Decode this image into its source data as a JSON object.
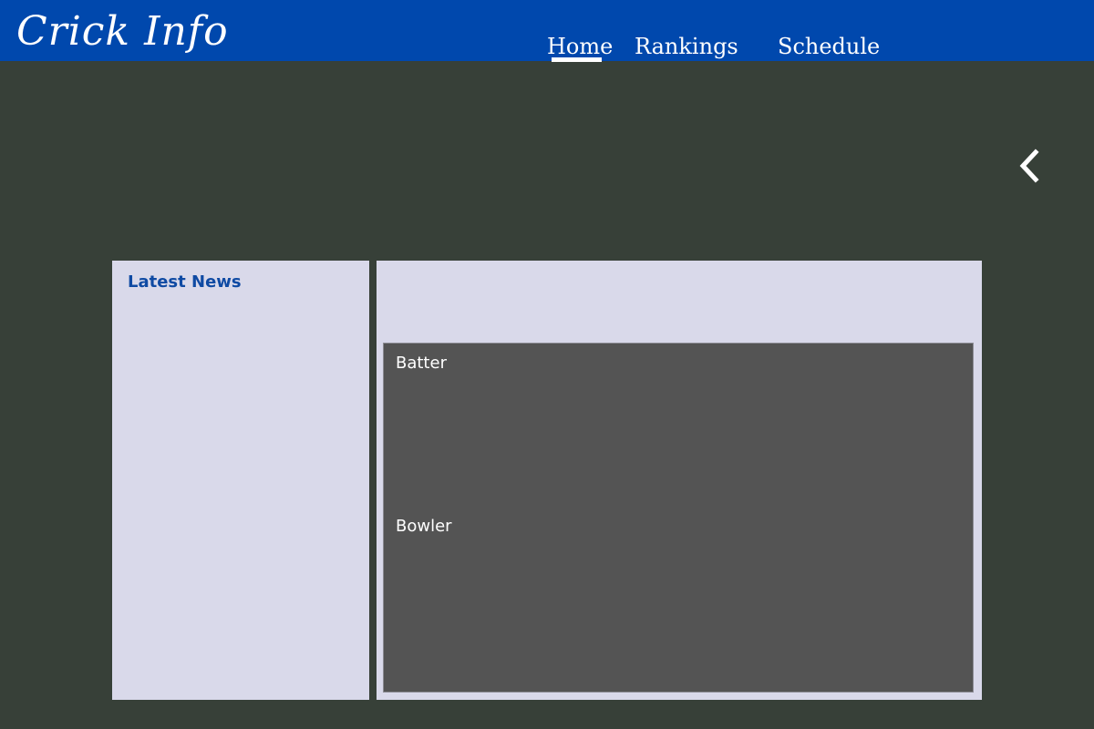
{
  "header": {
    "logo": "Crick Info",
    "nav": [
      {
        "label": "Home",
        "active": true
      },
      {
        "label": "Rankings",
        "active": false
      },
      {
        "label": "Schedule",
        "active": false
      }
    ]
  },
  "carousel": {
    "prev_icon": "chevron-left-icon"
  },
  "news": {
    "title": "Latest News"
  },
  "stats": {
    "batter_label": "Batter",
    "bowler_label": "Bowler"
  },
  "colors": {
    "header_bg": "#0048ad",
    "page_bg": "#374038",
    "panel_bg": "#d9d9ea",
    "stats_bg": "#545454",
    "news_title": "#0f4aa3"
  }
}
